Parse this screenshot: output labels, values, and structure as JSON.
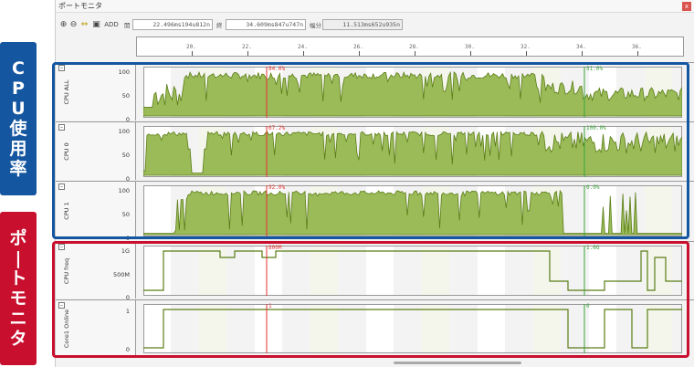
{
  "side_labels": {
    "cpu": [
      "C",
      "P",
      "U",
      "使",
      "用",
      "率"
    ],
    "portmon": [
      "ポ",
      "|",
      "ト",
      "モ",
      "ニ",
      "タ"
    ]
  },
  "window": {
    "title": "ポートモニタ",
    "close": "x"
  },
  "toolbar": {
    "add_label": "ADD",
    "start_label": "開",
    "start_value": "22.496ms194u812n",
    "end_label": "終",
    "end_value": "34.609ms847u747n",
    "span_label": "幅分",
    "span_value": "11.513ms652u935n"
  },
  "timeline": {
    "ticks": [
      "20.",
      "22.",
      "24.",
      "26.",
      "28.",
      "30.",
      "32.",
      "34.",
      "36."
    ]
  },
  "rows": [
    {
      "name": "CPU ALL",
      "ylabels": [
        "100",
        "50",
        "0"
      ],
      "red_marker": "84.6%",
      "green_marker": "51.0%"
    },
    {
      "name": "CPU 0",
      "ylabels": [
        "100",
        "50",
        "0"
      ],
      "red_marker": "67.2%",
      "green_marker": "100.0%"
    },
    {
      "name": "CPU 1",
      "ylabels": [
        "100",
        "50",
        "0"
      ],
      "red_marker": "92.0%",
      "green_marker": "0.0%"
    },
    {
      "name": "CPU freq",
      "ylabels": [
        "1G",
        "500M",
        "0"
      ],
      "red_marker": "800M",
      "green_marker": "1.6G"
    },
    {
      "name": "Core1 Online",
      "ylabels": [
        "1",
        "0"
      ],
      "red_marker": "1",
      "green_marker": "0"
    }
  ],
  "colors": {
    "fill": "#9bbb59",
    "line": "#5a7d16",
    "red_cursor": "#e53030",
    "green_cursor": "#3aa33a",
    "cpu_box": "#1556a0",
    "pm_box": "#c8102e"
  }
}
